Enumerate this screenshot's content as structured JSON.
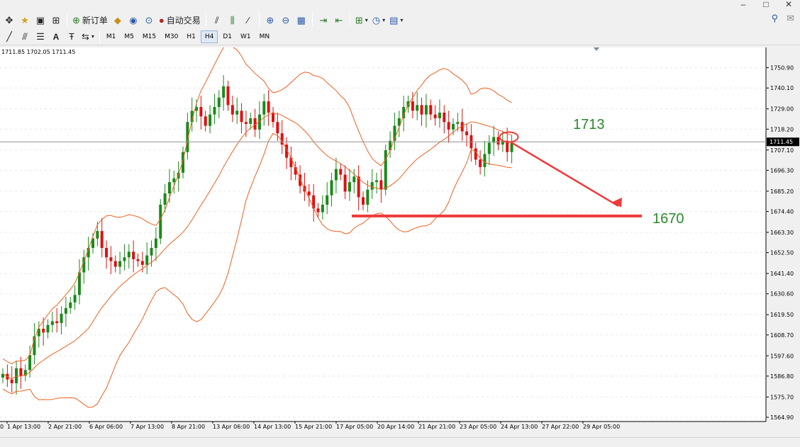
{
  "window": {
    "minimize": "–",
    "maximize": "□",
    "close": "✕"
  },
  "toolbar": {
    "new_order_label": "新订单",
    "auto_trade_label": "自动交易",
    "right_icons": [
      "search-icon",
      "chat-icon"
    ]
  },
  "timeframes": [
    "M1",
    "M5",
    "M15",
    "M30",
    "H1",
    "H4",
    "D1",
    "W1",
    "MN"
  ],
  "active_timeframe": "H4",
  "draw_tools": [
    "cursor",
    "crosshair",
    "line",
    "channel",
    "fibo",
    "text",
    "text-label",
    "arrows"
  ],
  "draw_text_label": "A",
  "info_line": "1711.85 1702.05 1711.45",
  "chart_data": {
    "type": "candlestick",
    "ylim": [
      1564.9,
      1756.4
    ],
    "y_ticks": [
      "1750.90",
      "1740.10",
      "1729.00",
      "1718.20",
      "1707.10",
      "1696.30",
      "1685.20",
      "1674.40",
      "1663.30",
      "1652.50",
      "1641.40",
      "1630.60",
      "1619.50",
      "1608.70",
      "1597.60",
      "1586.80",
      "1575.70",
      "1564.90"
    ],
    "current_price": "1711.45",
    "x_ticks": [
      "1 Apr 13:00",
      "2 Apr 21:00",
      "6 Apr 06:00",
      "7 Apr 13:00",
      "8 Apr 21:00",
      "13 Apr 06:00",
      "14 Apr 13:00",
      "15 Apr 21:00",
      "17 Apr 05:00",
      "20 Apr 14:00",
      "21 Apr 21:00",
      "23 Apr 05:00",
      "24 Apr 13:00",
      "27 Apr 22:00",
      "29 Apr 05:00"
    ],
    "x_tick_left_cut": "0",
    "annotation_high": "1713",
    "annotation_low": "1670",
    "support_level": 1672,
    "bull_color": "#1a8a1a",
    "bear_color": "#e01010",
    "band_color": "#f06020",
    "annotation_color": "#2a8a2a",
    "arrow_color": "#ef3a3a",
    "closes": [
      1588,
      1585,
      1583,
      1591,
      1587,
      1590,
      1598,
      1608,
      1612,
      1610,
      1614,
      1616,
      1615,
      1620,
      1623,
      1626,
      1630,
      1642,
      1650,
      1655,
      1660,
      1664,
      1655,
      1650,
      1648,
      1645,
      1648,
      1650,
      1653,
      1649,
      1648,
      1646,
      1651,
      1655,
      1660,
      1678,
      1684,
      1690,
      1692,
      1695,
      1706,
      1722,
      1728,
      1730,
      1725,
      1720,
      1726,
      1730,
      1735,
      1741,
      1731,
      1726,
      1728,
      1722,
      1721,
      1724,
      1718,
      1726,
      1733,
      1727,
      1722,
      1716,
      1710,
      1703,
      1698,
      1694,
      1688,
      1685,
      1683,
      1676,
      1674,
      1678,
      1683,
      1691,
      1697,
      1694,
      1685,
      1690,
      1693,
      1682,
      1678,
      1686,
      1690,
      1691,
      1686,
      1707,
      1712,
      1720,
      1724,
      1730,
      1733,
      1728,
      1731,
      1726,
      1731,
      1726,
      1724,
      1727,
      1722,
      1718,
      1721,
      1722,
      1717,
      1715,
      1708,
      1702,
      1698,
      1705,
      1711,
      1714,
      1710,
      1712,
      1706,
      1711
    ]
  }
}
